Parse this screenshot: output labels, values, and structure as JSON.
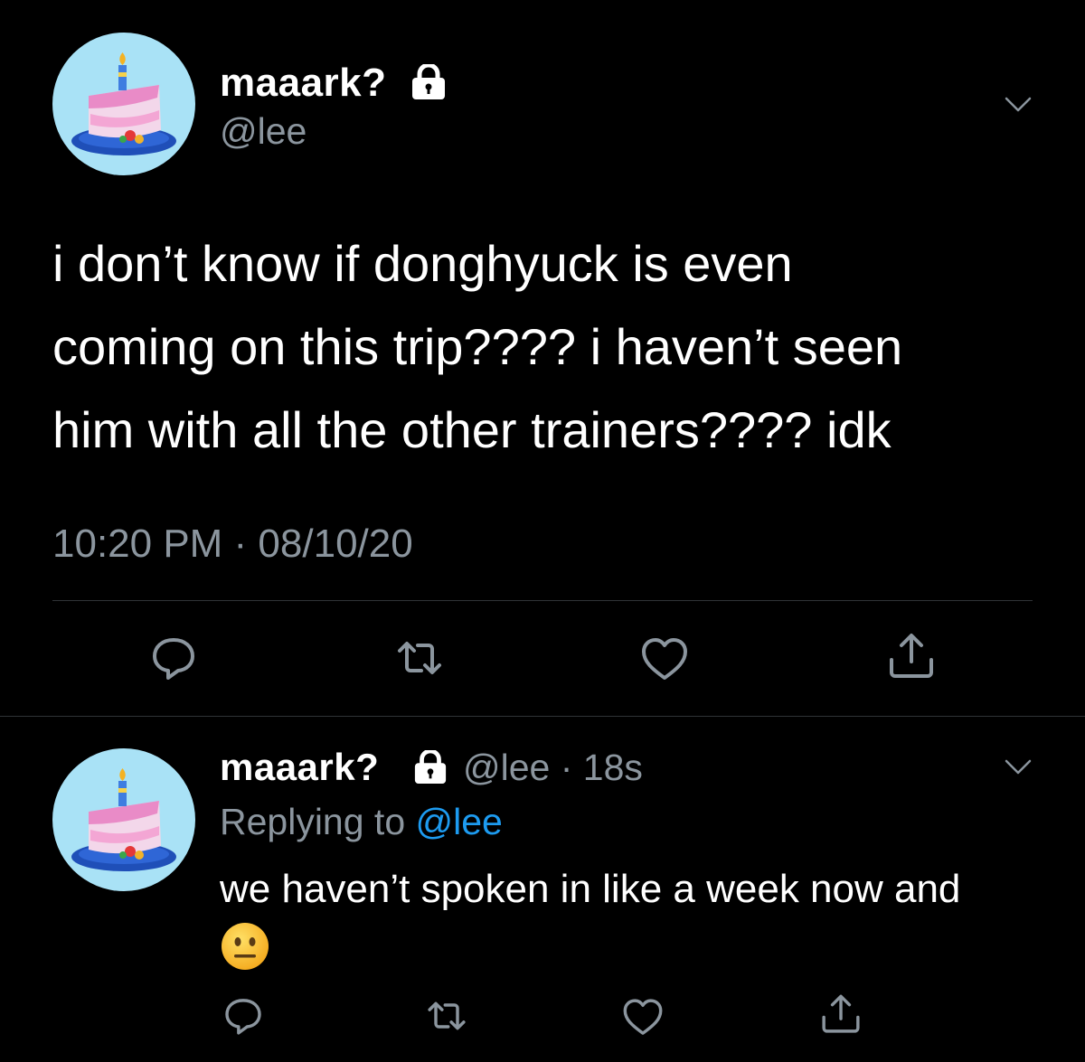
{
  "colors": {
    "background": "#000000",
    "text_primary": "#ffffff",
    "text_secondary": "#8b959e",
    "link": "#1d9bf0",
    "divider": "#2f3336",
    "avatar_bg": "#a9e2f6"
  },
  "main_tweet": {
    "display_name": "maaark?",
    "handle": "@lee",
    "lines": [
      "i don’t know if donghyuck is even",
      "coming on this trip???? i haven’t seen",
      "him with all the other trainers???? idk"
    ],
    "timestamp": "10:20 PM · 08/10/20",
    "icons": {
      "avatar": "cake-avatar-icon",
      "lock": "lock-icon",
      "menu": "chevron-down-icon",
      "actions": [
        "reply-icon",
        "retweet-icon",
        "like-icon",
        "share-icon"
      ]
    }
  },
  "reply_tweet": {
    "display_name": "maaark?",
    "handle_time": "@lee · 18s",
    "replying_prefix": "Replying to ",
    "replying_mention": "@lee",
    "text": "we haven’t spoken in like a week now and",
    "emoji": "neutral-face-emoji",
    "icons": {
      "avatar": "cake-avatar-icon",
      "lock": "lock-icon",
      "menu": "chevron-down-icon",
      "actions": [
        "reply-icon",
        "retweet-icon",
        "like-icon",
        "share-icon"
      ]
    }
  }
}
